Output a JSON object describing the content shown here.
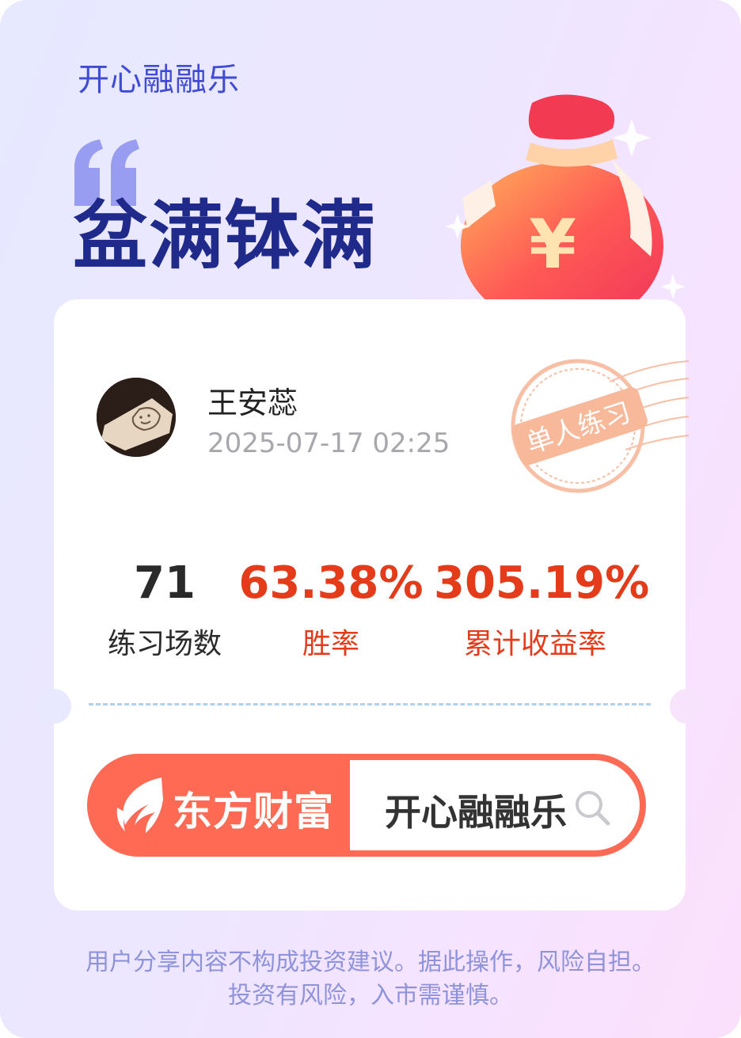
{
  "header": {
    "brand": "开心融融乐",
    "headline": "盆满钵满"
  },
  "profile": {
    "name": "王安蕊",
    "datetime": "2025-07-17 02:25",
    "badge": "单人练习"
  },
  "stats": [
    {
      "value": "71",
      "label": "练习场数"
    },
    {
      "value": "63.38%",
      "label": "胜率"
    },
    {
      "value": "305.19%",
      "label": "累计收益率"
    }
  ],
  "search": {
    "logo_text": "东方财富",
    "query": "开心融融乐"
  },
  "disclaimer": {
    "line1": "用户分享内容不构成投资建议。据此操作，风险自担。",
    "line2": "投资有风险，入市需谨慎。"
  },
  "icons": [
    "quote-icon",
    "moneybag-icon",
    "stamp-icon",
    "avatar-image",
    "eastmoney-logo-icon",
    "search-icon"
  ],
  "colors": {
    "accent_red": "#e43c1b",
    "brand_blue": "#3f4bd6",
    "headline_navy": "#1f2a8a",
    "searchbar_orange": "#ff6a55"
  }
}
